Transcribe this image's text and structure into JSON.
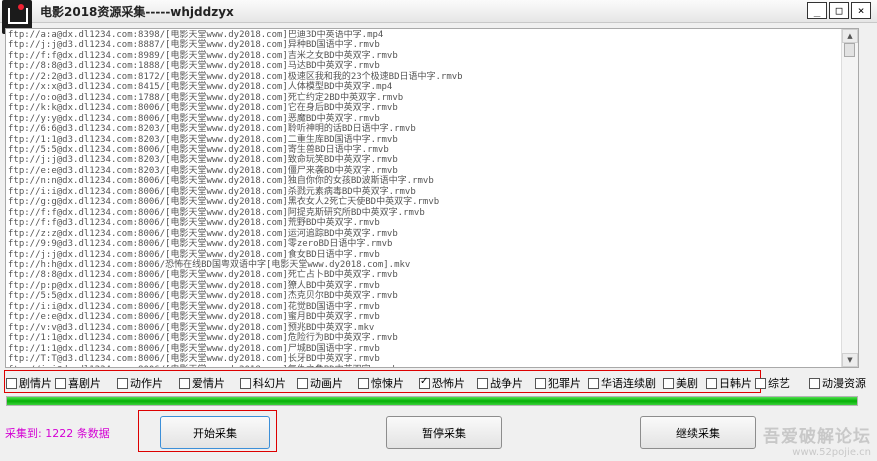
{
  "window": {
    "title": "电影2018资源采集-----whjddzyx",
    "controls": {
      "minimize": "_",
      "maximize": "□",
      "close": "×"
    }
  },
  "log": {
    "lines": [
      "ftp://a:a@dx.dl1234.com:8398/[电影天堂www.dy2018.com]巴迪3D中英语中字.mp4",
      "ftp://j:j@d3.dl1234.com:8887/[电影天堂www.dy2018.com]异种BD国语中字.rmvb",
      "ftp://f:f@dx.dl1234.com:8989/[电影天堂www.dy2018.com]吉米之女BD中英双字.rmvb",
      "ftp://8:8@d3.dl1234.com:1888/[电影天堂www.dy2018.com]马达BD中英双字.rmvb",
      "ftp://2:2@d3.dl1234.com:8172/[电影天堂www.dy2018.com]极速区我和我的23个极速BD日语中字.rmvb",
      "ftp://x:x@d3.dl1234.com:8415/[电影天堂www.dy2018.com]人体模型BD中英双字.mp4",
      "ftp://o:o@d3.dl1234.com:1788/[电影天堂www.dy2018.com]死亡约定2BD中英双字.rmvb",
      "ftp://k:k@dx.dl1234.com:8006/[电影天堂www.dy2018.com]它在身后BD中英双字.rmvb",
      "ftp://y:y@dx.dl1234.com:8006/[电影天堂www.dy2018.com]恶魔BD中英双字.rmvb",
      "ftp://6:6@d3.dl1234.com:8203/[电影天堂www.dy2018.com]聆听神明的话BD日语中字.rmvb",
      "ftp://1:1@d3.dl1234.com:8203/[电影天堂www.dy2018.com]二重生库BD国语中字.rmvb",
      "ftp://5:5@dx.dl1234.com:8006/[电影天堂www.dy2018.com]寄生兽BD日语中字.rmvb",
      "ftp://j:j@d3.dl1234.com:8203/[电影天堂www.dy2018.com]致命玩笑BD中英双字.rmvb",
      "ftp://e:e@d3.dl1234.com:8203/[电影天堂www.dy2018.com]僵尸来袭BD中英双字.rmvb",
      "ftp://n:n@dx.dl1234.com:8006/[电影天堂www.dy2018.com]独自你你的女孩BD波斯语中字.rmvb",
      "ftp://i:i@dx.dl1234.com:8006/[电影天堂www.dy2018.com]杀戮元素病毒BD中英双字.rmvb",
      "ftp://g:g@dx.dl1234.com:8006/[电影天堂www.dy2018.com]黑衣女人2死亡天使BD中英双字.rmvb",
      "ftp://f:f@dx.dl1234.com:8006/[电影天堂www.dy2018.com]阿提克斯研究所BD中英双字.rmvb",
      "ftp://f:f@d3.dl1234.com:8006/[电影天堂www.dy2018.com]荒野BD中英双字.rmvb",
      "ftp://z:z@dx.dl1234.com:8006/[电影天堂www.dy2018.com]运河追踪BD中英双字.rmvb",
      "ftp://9:9@d3.dl1234.com:8006/[电影天堂www.dy2018.com]零zeroBD日语中字.rmvb",
      "ftp://j:j@dx.dl1234.com:8006/[电影天堂www.dy2018.com]食女BD日语中字.rmvb",
      "ftp://h:h@dx.dl1234.com:8006/恐怖在线BD国粤双语中字[电影天堂www.dy2018.com].mkv",
      "ftp://8:8@dx.dl1234.com:8006/[电影天堂www.dy2018.com]死亡占卜BD中英双字.rmvb",
      "ftp://p:p@dx.dl1234.com:8006/[电影天堂www.dy2018.com]獠人BD中英双字.rmvb",
      "ftp://5:5@dx.dl1234.com:8006/[电影天堂www.dy2018.com]杰克贝尔BD中英双字.rmvb",
      "ftp://i:i@dx.dl1234.com:8006/[电影天堂www.dy2018.com]花觉BD国语中字.rmvb",
      "ftp://e:e@dx.dl1234.com:8006/[电影天堂www.dy2018.com]蜜月BD中英双字.rmvb",
      "ftp://v:v@d3.dl1234.com:8006/[电影天堂www.dy2018.com]预兆BD中英双字.mkv",
      "ftp://1:1@dx.dl1234.com:8006/[电影天堂www.dy2018.com]危险行为BD中英双字.rmvb",
      "ftp://1:1@dx.dl1234.com:8006/[电影天堂www.dy2018.com]尸城BD国语中字.rmvb",
      "ftp://T:T@d3.dl1234.com:8006/[电影天堂www.dy2018.com]长牙BD中英双字.rmvb",
      "ftp://i:i@dx.dl1234.com:8006/[电影天堂www.dy2018.com]复仇之角BD中英双字.rmvb",
      "ftp://z:z@dx.dl1234.com:8006/[电影天堂www.dy2018.com]青鬼BD日语中字.rmvb",
      "ftp://1:1@dx.dl1234.com:8006/[电影天堂www.dy2018.com]鬼屋之喧嚣大厦BD国语中字.mkv"
    ]
  },
  "categories": [
    {
      "label": "剧情片",
      "checked": false
    },
    {
      "label": "喜剧片",
      "checked": false
    },
    {
      "label": "动作片",
      "checked": false
    },
    {
      "label": "爱情片",
      "checked": false
    },
    {
      "label": "科幻片",
      "checked": false
    },
    {
      "label": "动画片",
      "checked": false
    },
    {
      "label": "惊悚片",
      "checked": false
    },
    {
      "label": "恐怖片",
      "checked": true
    },
    {
      "label": "战争片",
      "checked": false
    },
    {
      "label": "犯罪片",
      "checked": false
    },
    {
      "label": "华语连续剧",
      "checked": false
    },
    {
      "label": "美剧",
      "checked": false
    },
    {
      "label": "日韩片",
      "checked": false
    },
    {
      "label": "综艺",
      "checked": false
    },
    {
      "label": "动漫资源",
      "checked": false
    }
  ],
  "progress": {
    "percent": 100,
    "color": "#0cb80c"
  },
  "status": {
    "count_text": "采集到: 1222 条数据"
  },
  "buttons": {
    "start": "开始采集",
    "pause": "暂停采集",
    "resume": "继续采集"
  },
  "watermark": {
    "line1": "吾爱破解论坛",
    "line2": "www.52pojie.cn"
  }
}
